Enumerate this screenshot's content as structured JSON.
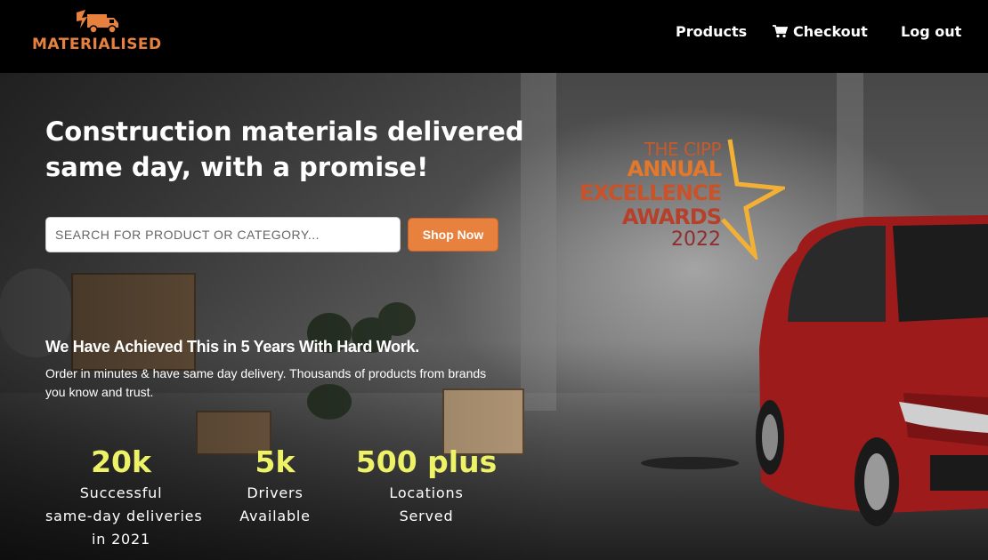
{
  "brand": {
    "name": "MATERIALISED",
    "logo_icon": "delivery-truck-icon",
    "accent_color": "#e8813e"
  },
  "nav": {
    "products": "Products",
    "checkout": "Checkout",
    "checkout_icon": "cart-icon",
    "logout": "Log out"
  },
  "hero": {
    "headline": "Construction materials delivered same day, with a promise!",
    "search": {
      "placeholder": "SEARCH FOR PRODUCT OR CATEGORY...",
      "value": ""
    },
    "shop_button": "Shop Now",
    "award": {
      "line1": "THE CIPP",
      "line2": "ANNUAL",
      "line3": "EXCELLENCE",
      "line4": "AWARDS",
      "line5": "2022"
    },
    "achievement_title": "We Have Achieved This in 5 Years With Hard Work.",
    "achievement_text": "Order in minutes & have same day delivery. Thousands of products from brands you know and trust.",
    "stat_color": "#eef266",
    "stats": [
      {
        "value": "20k",
        "label_lines": [
          "Successful",
          "same-day deliveries",
          "in 2021"
        ]
      },
      {
        "value": "5k",
        "label_lines": [
          "Drivers",
          "Available"
        ]
      },
      {
        "value": "500 plus",
        "label_lines": [
          "Locations",
          "Served"
        ]
      }
    ]
  }
}
